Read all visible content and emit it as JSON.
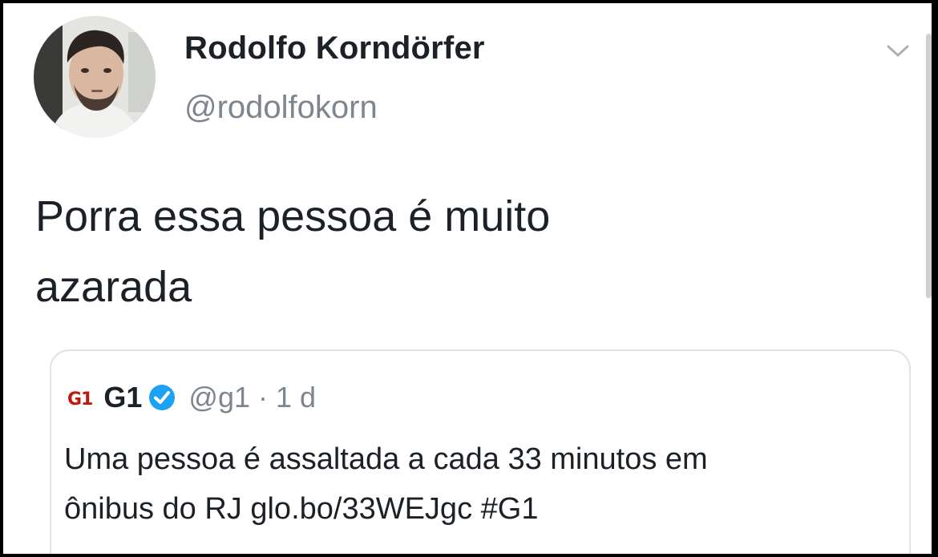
{
  "tweet": {
    "author": {
      "display_name": "Rodolfo Korndörfer",
      "handle": "@rodolfokorn"
    },
    "text": "Porra essa pessoa é muito\nazarada",
    "menu_icon": "chevron-down-icon"
  },
  "quoted_tweet": {
    "logo_text": "G1",
    "display_name": "G1",
    "verified": true,
    "verified_color": "#1da1f2",
    "handle": "@g1",
    "separator": "·",
    "time": "1 d",
    "text": "Uma pessoa é assaltada a cada 33 minutos em\nônibus do RJ glo.bo/33WEJgc #G1"
  },
  "colors": {
    "background": "#ffffff",
    "text": "#1c2127",
    "secondary_text": "#7d868f",
    "g1_brand": "#c4170c",
    "frame": "#000000"
  }
}
